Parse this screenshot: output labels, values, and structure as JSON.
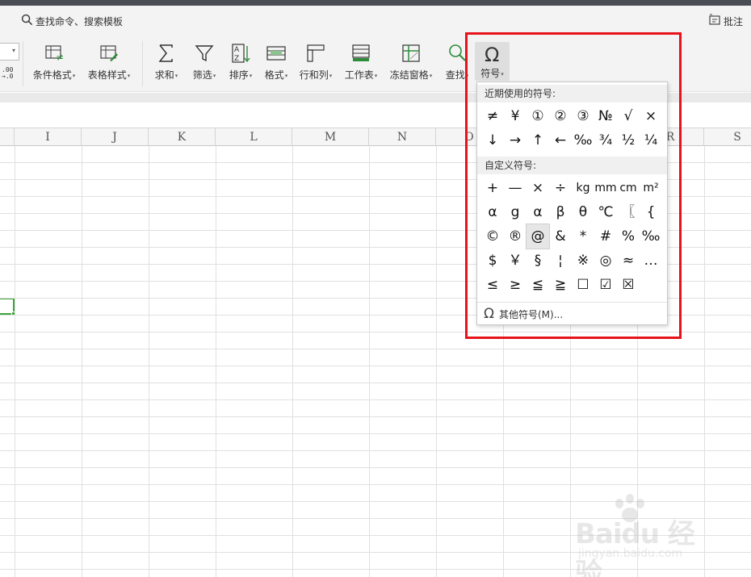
{
  "command_bar": {
    "search_label": "查找命令、搜索模板",
    "comment_label": "批注"
  },
  "ribbon": {
    "tools": [
      {
        "label": "条件格式",
        "icon": "conditional-format-icon"
      },
      {
        "label": "表格样式",
        "icon": "table-style-icon"
      },
      {
        "label": "求和",
        "icon": "sum-icon"
      },
      {
        "label": "筛选",
        "icon": "filter-icon"
      },
      {
        "label": "排序",
        "icon": "sort-icon"
      },
      {
        "label": "格式",
        "icon": "format-icon"
      },
      {
        "label": "行和列",
        "icon": "rows-columns-icon"
      },
      {
        "label": "工作表",
        "icon": "worksheet-icon"
      },
      {
        "label": "冻结窗格",
        "icon": "freeze-panes-icon"
      },
      {
        "label": "查找",
        "icon": "find-icon"
      },
      {
        "label": "符号",
        "icon": "omega-icon"
      }
    ],
    "decimal_text": ".00\n→.0"
  },
  "columns": [
    "I",
    "J",
    "K",
    "L",
    "M",
    "N",
    "O",
    "R",
    "S"
  ],
  "symbol_panel": {
    "recent_title": "近期使用的符号:",
    "recent_symbols": [
      "≠",
      "¥",
      "①",
      "②",
      "③",
      "№",
      "√",
      "×",
      "↓",
      "→",
      "↑",
      "←",
      "‰",
      "¾",
      "½",
      "¼"
    ],
    "custom_title": "自定义符号:",
    "custom_symbols": [
      "+",
      "—",
      "×",
      "÷",
      "kg",
      "mm",
      "cm",
      "m²",
      "α",
      "g",
      "α",
      "β",
      "θ",
      "℃",
      "〖",
      "{",
      "©",
      "®",
      "@",
      "&",
      "*",
      "#",
      "%",
      "‰",
      "$",
      "￥",
      "§",
      "¦",
      "※",
      "◎",
      "≈",
      "…",
      "≤",
      "≥",
      "≦",
      "≧",
      "☐",
      "☑",
      "☒"
    ],
    "more_label": "其他符号(M)..."
  },
  "colors": {
    "highlight": "#e8131a",
    "selection": "#3fa53a",
    "ribbon_bg": "#f3f3f3"
  }
}
